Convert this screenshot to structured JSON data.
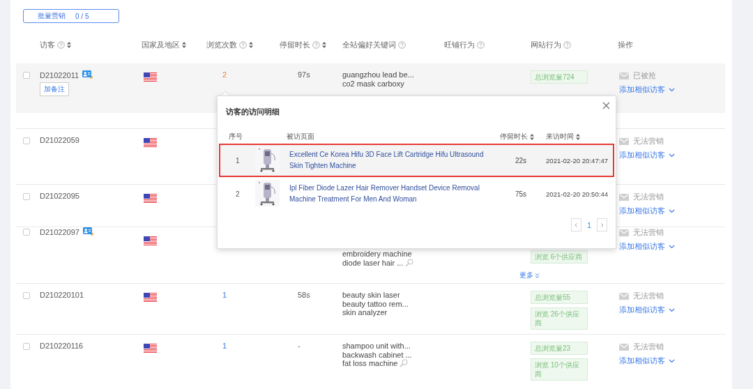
{
  "batch_button": {
    "label": "批量营销",
    "count": "0 / 5"
  },
  "columns": [
    {
      "label": "访客",
      "help": true,
      "sortable": true
    },
    {
      "label": "国家及地区",
      "help": false,
      "sortable": true
    },
    {
      "label": "浏览次数",
      "help": true,
      "sortable": true
    },
    {
      "label": "停留时长",
      "help": true,
      "sortable": true
    },
    {
      "label": "全站偏好关键词",
      "help": true,
      "sortable": false
    },
    {
      "label": "旺铺行为",
      "help": true,
      "sortable": false
    },
    {
      "label": "网站行为",
      "help": true,
      "sortable": false
    },
    {
      "label": "操作",
      "help": false,
      "sortable": false
    }
  ],
  "rows": [
    {
      "visitor": "D21022011",
      "card": true,
      "note_button": "加备注",
      "hovered": true,
      "checked": false,
      "views": {
        "text": "2",
        "active": true
      },
      "duration": "97s",
      "keywords": [
        {
          "text": "guangzhou lead be...",
          "search": false
        },
        {
          "text": "co2 mask carboxy",
          "search": false
        }
      ],
      "tags": [
        "总浏览量724"
      ],
      "status": "已被抢",
      "similar": "添加相似访客"
    },
    {
      "visitor": "D21022059",
      "card": false,
      "hovered": false,
      "checked": false,
      "status": "无法营销",
      "similar": "添加相似访客"
    },
    {
      "visitor": "D21022095",
      "card": false,
      "hovered": false,
      "checked": false,
      "status": "无法营销",
      "similar": "添加相似访客"
    },
    {
      "visitor": "D21022097",
      "card": true,
      "hovered": false,
      "checked": false,
      "keywords": [
        {
          "text": "embroidery machine",
          "search": false
        },
        {
          "text": "diode laser hair ...",
          "search": true
        }
      ],
      "tags": [
        "浏览 6个供应商"
      ],
      "more": "更多",
      "status": "无法营销",
      "similar": "添加相似访客"
    },
    {
      "visitor": "D210220101",
      "card": false,
      "hovered": false,
      "checked": false,
      "views": {
        "text": "1",
        "active": false
      },
      "duration": "58s",
      "keywords": [
        {
          "text": "beauty skin laser",
          "search": false
        },
        {
          "text": "beauty tattoo rem...",
          "search": false
        },
        {
          "text": "skin analyzer",
          "search": false
        }
      ],
      "tags": [
        "总浏览量55",
        "浏览 26个供应商"
      ],
      "status": "无法营销",
      "similar": "添加相似访客"
    },
    {
      "visitor": "D210220116",
      "card": false,
      "hovered": false,
      "checked": false,
      "views": {
        "text": "1",
        "active": false
      },
      "duration": "-",
      "keywords": [
        {
          "text": "shampoo unit with...",
          "search": false
        },
        {
          "text": "backwash cabinet ...",
          "search": false
        },
        {
          "text": "fat loss machine",
          "search": true
        }
      ],
      "tags": [
        "总浏览量23",
        "浏览 10个供应商"
      ],
      "status": "无法营销",
      "similar": "添加相似访客"
    }
  ],
  "popup": {
    "title": "访客的访问明细",
    "columns": [
      {
        "label": "序号",
        "sortable": false
      },
      {
        "label": "被访页面",
        "sortable": false
      },
      {
        "label": "停留时长",
        "sortable": true
      },
      {
        "label": "来访时间",
        "sortable": true
      }
    ],
    "rows": [
      {
        "index": "1",
        "page": "Excellent Ce Korea Hifu 3D Face Lift Cartridge Hifu Ultrasound Skin Tighten Machine",
        "duration": "22s",
        "time": "2021-02-20 20:47:47",
        "selected": true
      },
      {
        "index": "2",
        "page": "Ipl Fiber Diode Lazer Hair Remover Handset Device Removal Machine Treatment For Men And Woman",
        "duration": "75s",
        "time": "2021-02-20 20:50:44",
        "selected": false
      }
    ],
    "pages": [
      {
        "label": "1",
        "selected": true
      }
    ]
  }
}
